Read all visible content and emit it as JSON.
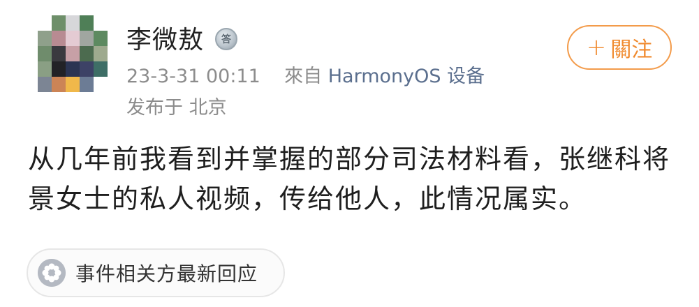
{
  "post": {
    "username": "李微敖",
    "badge_text": "答",
    "timestamp": "23-3-31 00:11",
    "source_prefix": "來自",
    "source_device": "HarmonyOS 设备",
    "location": "发布于 北京",
    "follow_label": "關注",
    "follow_plus": "+",
    "content": "从几年前我看到并掌握的部分司法材料看，张继科将景女士的私人视频，传给他人，此情况属实。",
    "response_label": "事件相关方最新回应"
  },
  "colors": {
    "follow_accent": "#f08a2e",
    "source_link": "#5b6f8e",
    "meta_gray": "#8c8c8c"
  },
  "icons": {
    "medal": "medal-icon",
    "response": "flower-icon"
  }
}
